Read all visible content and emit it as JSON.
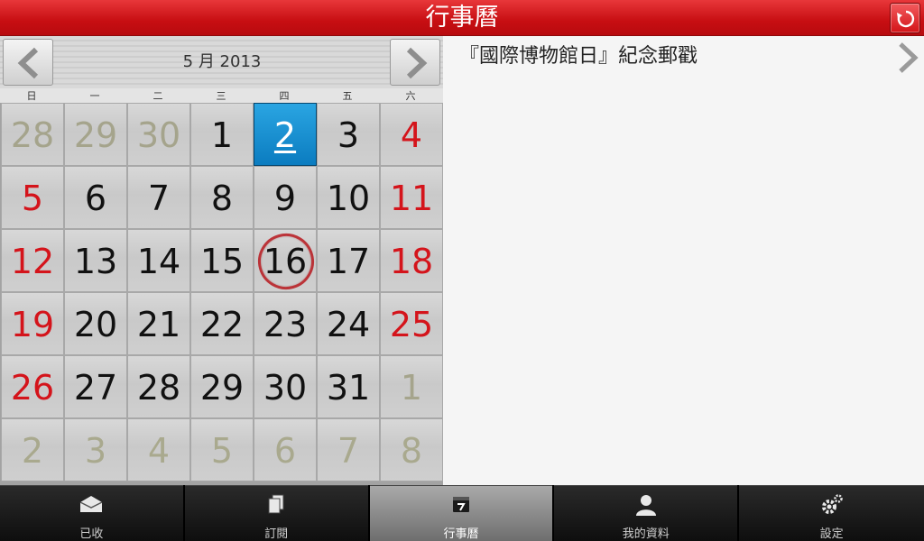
{
  "titlebar": {
    "title": "行事曆"
  },
  "calendar": {
    "month_label": "5 月 2013",
    "weekdays": [
      "日",
      "一",
      "二",
      "三",
      "四",
      "五",
      "六"
    ],
    "weeks": [
      [
        "28",
        "29",
        "30",
        "1",
        "2",
        "3",
        "4"
      ],
      [
        "5",
        "6",
        "7",
        "8",
        "9",
        "10",
        "11"
      ],
      [
        "12",
        "13",
        "14",
        "15",
        "16",
        "17",
        "18"
      ],
      [
        "19",
        "20",
        "21",
        "22",
        "23",
        "24",
        "25"
      ],
      [
        "26",
        "27",
        "28",
        "29",
        "30",
        "31",
        "1"
      ],
      [
        "2",
        "3",
        "4",
        "5",
        "6",
        "7",
        "8"
      ]
    ],
    "selected_day": "2",
    "event_day": "16"
  },
  "detail": {
    "event_title": "『國際博物館日』紀念郵戳"
  },
  "tabs": [
    {
      "label": "已收",
      "icon": "envelope-icon"
    },
    {
      "label": "訂閱",
      "icon": "documents-icon"
    },
    {
      "label": "行事曆",
      "icon": "calendar-icon",
      "active": true
    },
    {
      "label": "我的資料",
      "icon": "person-icon"
    },
    {
      "label": "設定",
      "icon": "gears-icon"
    }
  ],
  "colors": {
    "brand_red": "#d0161a",
    "weekend_red": "#d4141b",
    "today_blue": "#1790d3"
  }
}
